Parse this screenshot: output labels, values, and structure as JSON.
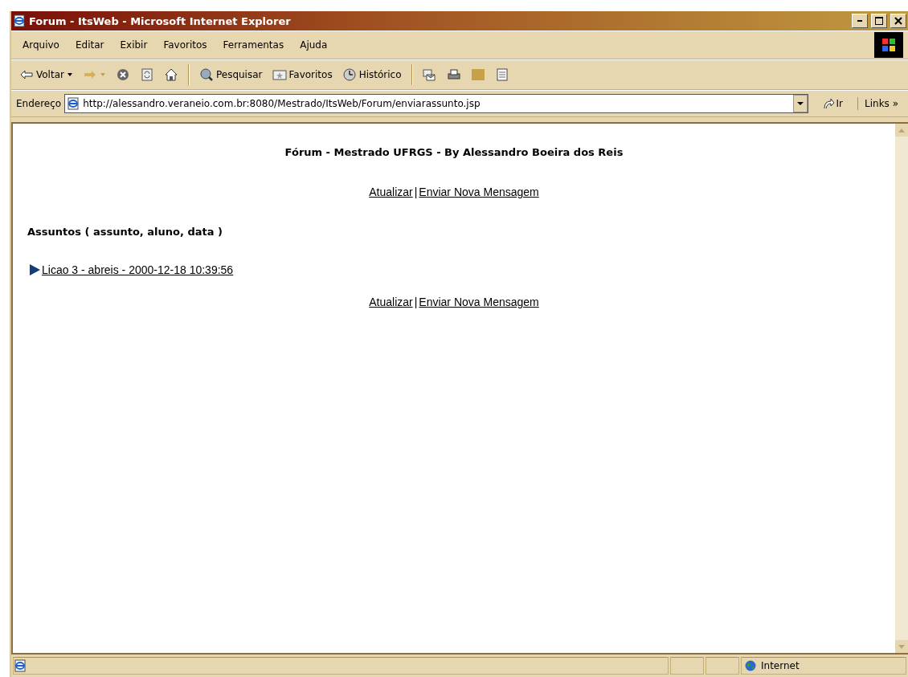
{
  "window": {
    "title": "Forum - ItsWeb - Microsoft Internet Explorer"
  },
  "menu": [
    "Arquivo",
    "Editar",
    "Exibir",
    "Favoritos",
    "Ferramentas",
    "Ajuda"
  ],
  "toolbar": [
    {
      "kind": "back",
      "label": "Voltar"
    },
    {
      "kind": "forward"
    },
    {
      "kind": "stop"
    },
    {
      "kind": "refresh"
    },
    {
      "kind": "home"
    },
    {
      "kind": "sep"
    },
    {
      "kind": "search",
      "label": "Pesquisar"
    },
    {
      "kind": "favorites",
      "label": "Favoritos"
    },
    {
      "kind": "history",
      "label": "Histórico"
    },
    {
      "kind": "sep"
    },
    {
      "kind": "mail"
    },
    {
      "kind": "print"
    },
    {
      "kind": "edit"
    },
    {
      "kind": "discuss"
    }
  ],
  "address": {
    "label": "Endereço",
    "value": "http://alessandro.veraneio.com.br:8080/Mestrado/ItsWeb/Forum/enviarassunto.jsp",
    "go": "Ir",
    "links": "Links",
    "more": "»"
  },
  "page": {
    "heading": "Fórum - Mestrado UFRGS - By Alessandro Boeira dos Reis",
    "nav_top": {
      "refresh": "Atualizar",
      "separator": "|",
      "new_message": "Enviar Nova Mensagem"
    },
    "section_title": "Assuntos ( assunto, aluno, data )",
    "topics": [
      "Licao 3 - abreis - 2000-12-18 10:39:56"
    ],
    "nav_bottom": {
      "refresh": "Atualizar",
      "separator": "|",
      "new_message": "Enviar Nova Mensagem"
    }
  },
  "status_bar": {
    "zone": "Internet"
  }
}
